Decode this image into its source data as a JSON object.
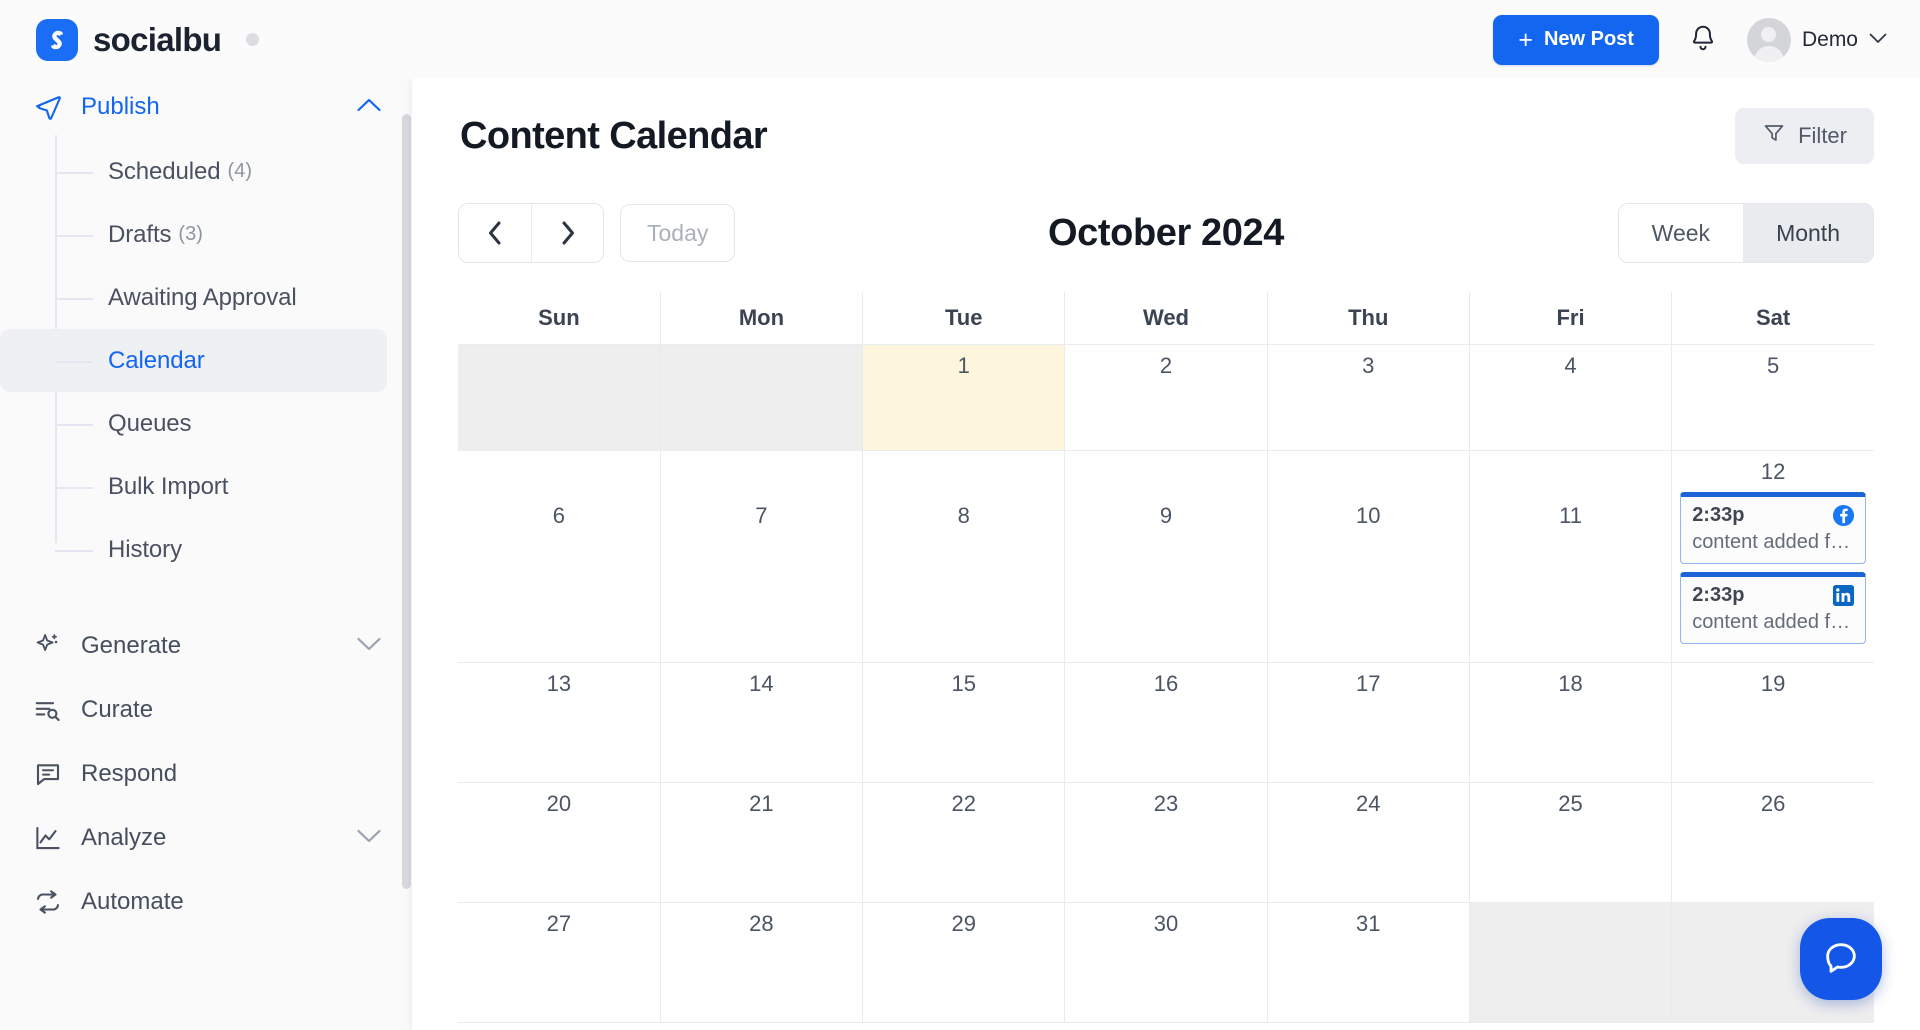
{
  "brand": {
    "name": "socialbu",
    "logo_letter": "S"
  },
  "header": {
    "new_post_label": "New Post",
    "plus_glyph": "+",
    "user_name": "Demo",
    "caret_glyph": "⌄"
  },
  "sidebar": {
    "publish": {
      "label": "Publish",
      "children": [
        {
          "label": "Scheduled",
          "count": "(4)",
          "selected": false
        },
        {
          "label": "Drafts",
          "count": "(3)",
          "selected": false
        },
        {
          "label": "Awaiting Approval",
          "count": "",
          "selected": false
        },
        {
          "label": "Calendar",
          "count": "",
          "selected": true
        },
        {
          "label": "Queues",
          "count": "",
          "selected": false
        },
        {
          "label": "Bulk Import",
          "count": "",
          "selected": false
        },
        {
          "label": "History",
          "count": "",
          "selected": false
        }
      ]
    },
    "items": [
      {
        "label": "Generate",
        "icon": "sparkle-icon",
        "has_chevron": true
      },
      {
        "label": "Curate",
        "icon": "curate-icon",
        "has_chevron": false
      },
      {
        "label": "Respond",
        "icon": "respond-icon",
        "has_chevron": false
      },
      {
        "label": "Analyze",
        "icon": "analyze-icon",
        "has_chevron": true
      },
      {
        "label": "Automate",
        "icon": "automate-icon",
        "has_chevron": false
      }
    ]
  },
  "main": {
    "page_title": "Content Calendar",
    "filter_label": "Filter",
    "toolbar": {
      "prev_glyph": "‹",
      "next_glyph": "›",
      "today_label": "Today",
      "month_title": "October 2024",
      "view_week_label": "Week",
      "view_month_label": "Month",
      "active_view": "Month"
    },
    "calendar": {
      "weekday_headers": [
        "Sun",
        "Mon",
        "Tue",
        "Wed",
        "Thu",
        "Fri",
        "Sat"
      ],
      "weeks": [
        [
          {
            "day": "",
            "blank": true
          },
          {
            "day": "",
            "blank": true
          },
          {
            "day": "1",
            "today": true
          },
          {
            "day": "2"
          },
          {
            "day": "3"
          },
          {
            "day": "4"
          },
          {
            "day": "5"
          }
        ],
        [
          {
            "day": "6"
          },
          {
            "day": "7"
          },
          {
            "day": "8"
          },
          {
            "day": "9"
          },
          {
            "day": "10"
          },
          {
            "day": "11"
          },
          {
            "day": "12",
            "events": [
              {
                "time": "2:33p",
                "text": "content added f…",
                "platform": "facebook"
              },
              {
                "time": "2:33p",
                "text": "content added f…",
                "platform": "linkedin"
              }
            ]
          }
        ],
        [
          {
            "day": "13"
          },
          {
            "day": "14"
          },
          {
            "day": "15"
          },
          {
            "day": "16"
          },
          {
            "day": "17"
          },
          {
            "day": "18"
          },
          {
            "day": "19"
          }
        ],
        [
          {
            "day": "20"
          },
          {
            "day": "21"
          },
          {
            "day": "22"
          },
          {
            "day": "23"
          },
          {
            "day": "24"
          },
          {
            "day": "25"
          },
          {
            "day": "26"
          }
        ],
        [
          {
            "day": "27"
          },
          {
            "day": "28"
          },
          {
            "day": "29"
          },
          {
            "day": "30"
          },
          {
            "day": "31"
          },
          {
            "day": "",
            "blank": true
          },
          {
            "day": "",
            "blank": true
          }
        ]
      ]
    }
  },
  "colors": {
    "brand_blue": "#1366f0",
    "event_border": "#1b63d6",
    "today_highlight": "#fdf6dc",
    "blank_cell": "#eeeeef",
    "facebook": "#1877f2",
    "linkedin": "#0a66c2"
  }
}
